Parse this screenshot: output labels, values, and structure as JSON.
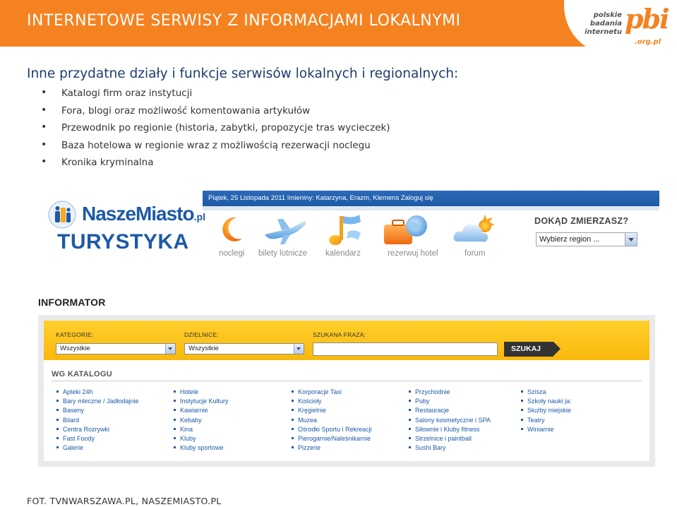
{
  "header": {
    "title": "INTERNETOWE SERWISY Z INFORMACJAMI LOKALNYMI",
    "logo": {
      "line1": "polskie",
      "line2": "badania",
      "line3": "internetu",
      "mark": "pbi",
      "domain": ".org.pl",
      "accent": "#f58220"
    }
  },
  "content": {
    "subtitle": "Inne przydatne działy i funkcje serwisów lokalnych i regionalnych:",
    "bullets": [
      "Katalogi firm oraz instytucji",
      "Fora, blogi oraz możliwość komentowania artykułów",
      "Przewodnik po regionie (historia, zabytki, propozycje tras wycieczek)",
      "Baza hotelowa w regionie wraz z możliwością rezerwacji noclegu",
      "Kronika kryminalna"
    ]
  },
  "screenshot1": {
    "topbar_text": "Piątek, 25 Listopada 2011 Imieniny: Katarzyna, Erazm, Klemens   Zaloguj się",
    "logo_name": "NaszeMiasto",
    "logo_suffix": ".pl",
    "section": "TURYSTYKA",
    "nav": [
      {
        "label": "noclegi",
        "icon": "moon-icon"
      },
      {
        "label": "bilety lotnicze",
        "icon": "airplane-icon"
      },
      {
        "label": "kalendarz",
        "icon": "music-note-icon"
      },
      {
        "label": "rezerwuj hotel",
        "icon": "suitcase-icon"
      },
      {
        "label": "forum",
        "icon": "cloud-sun-icon"
      }
    ],
    "destination_label": "DOKĄD ZMIERZASZ?",
    "region_select": "Wybierz region ..."
  },
  "screenshot2": {
    "title": "INFORMATOR",
    "filters": {
      "kategorie_label": "KATEGORIE:",
      "kategorie_value": "Wszystkie",
      "dzielnice_label": "DZIELNICE:",
      "dzielnice_value": "Wszystkie",
      "fraza_label": "SZUKANA FRAZA:",
      "search_button": "SZUKAJ"
    },
    "catalog_title": "WG KATALOGU",
    "columns": [
      [
        "Apteki 24h",
        "Bary mleczne / Jadłodajnie",
        "Baseny",
        "Bilard",
        "Centra Rozrywki",
        "Fast Foody",
        "Galerie"
      ],
      [
        "Hotele",
        "Instytucje Kultury",
        "Kawiarnie",
        "Kebaby",
        "Kina",
        "Kluby",
        "Kluby sportowe"
      ],
      [
        "Korporacje Taxi",
        "Kościoły",
        "Kręgielnie",
        "Muzea",
        "Ośrodki Sportu i Rekreacji",
        "Pierogarnie/Naleśnikarnie",
        "Pizzerie"
      ],
      [
        "Przychodnie",
        "Puby",
        "Restauracje",
        "Salony kosmetyczne i SPA",
        "Siłownie i Kluby fitness",
        "Strzelnice i paintball",
        "Sushi Bary"
      ],
      [
        "Szisza",
        "Szkoły nauki ja:",
        "Służby miejskie",
        "Teatry",
        "Winiarnie"
      ]
    ]
  },
  "caption": "FOT. TVNWARSZAWA.PL, NASZEMIASTO.PL"
}
